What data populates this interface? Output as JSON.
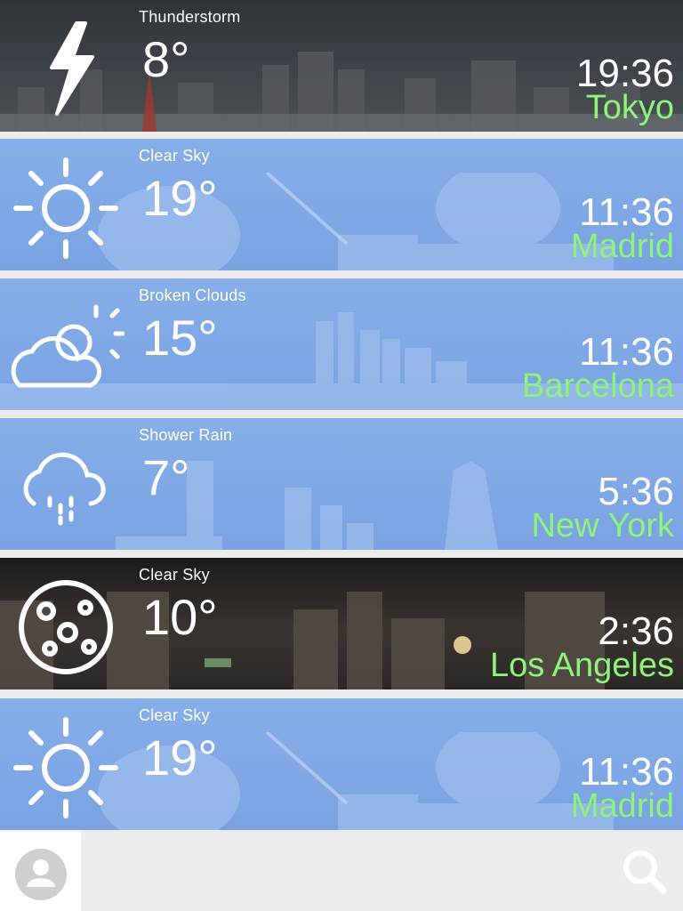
{
  "cities": [
    {
      "condition": "Thunderstorm",
      "temp": "8°",
      "time": "19:36",
      "city": "Tokyo",
      "icon": "lightning-icon",
      "theme": "dark"
    },
    {
      "condition": "Clear Sky",
      "temp": "19°",
      "time": "11:36",
      "city": "Madrid",
      "icon": "sun-icon",
      "theme": "blue"
    },
    {
      "condition": "Broken Clouds",
      "temp": "15°",
      "time": "11:36",
      "city": "Barcelona",
      "icon": "cloud-sun-icon",
      "theme": "blue"
    },
    {
      "condition": "Shower Rain",
      "temp": "7°",
      "time": "5:36",
      "city": "New York",
      "icon": "rain-cloud-icon",
      "theme": "blue"
    },
    {
      "condition": "Clear Sky",
      "temp": "10°",
      "time": "2:36",
      "city": "Los Angeles",
      "icon": "moon-icon",
      "theme": "night"
    },
    {
      "condition": "Clear Sky",
      "temp": "19°",
      "time": "11:36",
      "city": "Madrid",
      "icon": "sun-icon",
      "theme": "blue"
    }
  ],
  "colors": {
    "city": "#8ff57a",
    "text": "#ffffff",
    "bar": "#ececec"
  },
  "bottom_bar": {
    "profile_icon": "user-icon",
    "search_icon": "search-icon"
  }
}
